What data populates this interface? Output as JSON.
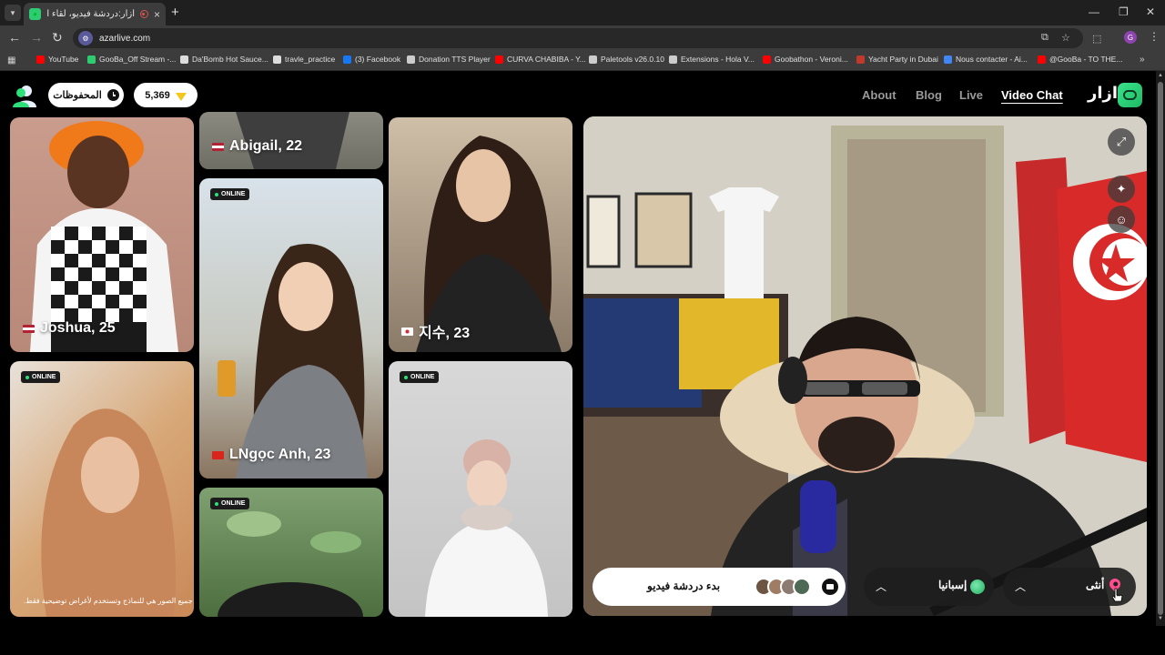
{
  "browser": {
    "tab_title": "أزار:دردشة فيديو، لقاء الأصدقاء",
    "tab_close": "×",
    "new_tab": "+",
    "url": "azarlive.com",
    "bookmarks": [
      {
        "label": "YouTube",
        "color": "#ff0000"
      },
      {
        "label": "GooBa_Off Stream -...",
        "color": "#2ecc71"
      },
      {
        "label": "Da'Bomb Hot Sauce...",
        "color": "#dddddd"
      },
      {
        "label": "travle_practice",
        "color": "#dddddd"
      },
      {
        "label": "(3) Facebook",
        "color": "#1877f2"
      },
      {
        "label": "Donation TTS Player",
        "color": "#cccccc"
      },
      {
        "label": "CURVA CHABIBA - Y...",
        "color": "#ff0000"
      },
      {
        "label": "Paletools v26.0.10",
        "color": "#cccccc"
      },
      {
        "label": "Extensions - Hola V...",
        "color": "#cccccc"
      },
      {
        "label": "Goobathon - Veroni...",
        "color": "#ff0000"
      },
      {
        "label": "Yacht Party in Dubai",
        "color": "#c0392b"
      },
      {
        "label": "Nous contacter - Ai...",
        "color": "#4285f4"
      },
      {
        "label": "@GooBa - TO THE...",
        "color": "#ff0000"
      }
    ]
  },
  "header": {
    "saved_label": "المحفوظات",
    "gems_count": "5,369",
    "nav": [
      "About",
      "Blog",
      "Live",
      "Video Chat"
    ],
    "active_nav": "Video Chat",
    "logo_text": "ازار"
  },
  "grid": {
    "online_label": "ONLINE",
    "cards": [
      {
        "name": "Joshua, 25",
        "flag": "us"
      },
      {
        "name": "Abigail, 22",
        "flag": "us"
      },
      {
        "name": "LNgọc Anh, 23",
        "flag": "vn"
      },
      {
        "name": "지수, 23",
        "flag": "kr"
      }
    ],
    "disclaimer": "جميع الصور هي للنماذج وتستخدم لأغراض توضيحية فقط."
  },
  "controls": {
    "start_label": "بدء دردشة فيديو",
    "country_label": "إسبانيا",
    "gender_label": "أنثى"
  },
  "colors": {
    "accent_green": "#2ee07a",
    "gem_gold": "#f5c518",
    "pin_pink": "#ff4d8d"
  }
}
